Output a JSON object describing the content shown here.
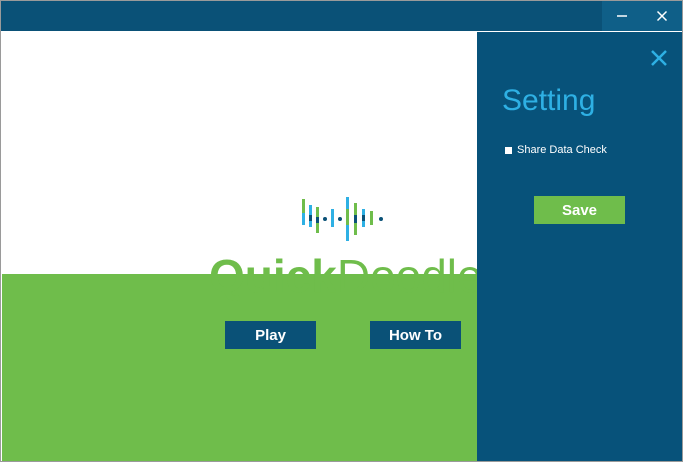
{
  "titlebar": {
    "minimize_icon": "minimize-icon",
    "close_icon": "close-icon"
  },
  "main": {
    "brand_quick": "Quick",
    "brand_doodle": "Doodle",
    "play_label": "Play",
    "howto_label": "How To",
    "exit_icon": "exit-door-icon"
  },
  "settings": {
    "title": "Setting",
    "checkbox_label": "Share Data Check",
    "save_label": "Save",
    "close_icon": "close-icon"
  },
  "colors": {
    "titlebar": "#0a5177",
    "panel": "#07527a",
    "brand_green": "#6fbd4b",
    "accent_blue": "#2eb0e4",
    "button_navy": "#0a5177"
  }
}
